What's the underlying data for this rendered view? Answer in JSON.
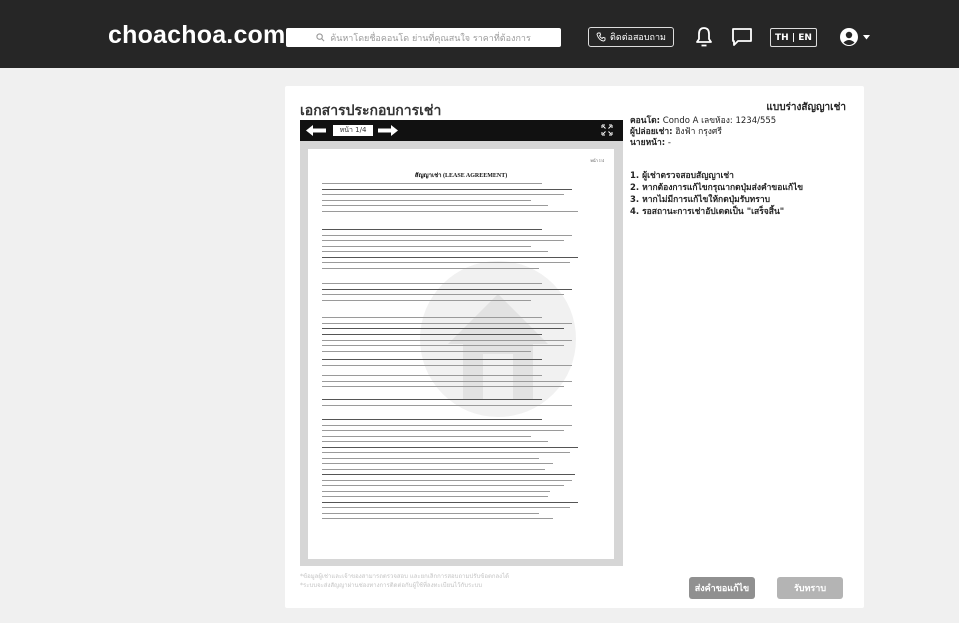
{
  "header": {
    "logo": "choachoa.com",
    "search_placeholder": "ค้นหาโดยชื่อคอนโด ย่านที่คุณสนใจ ราคาที่ต้องการ",
    "contact_label": "ติดต่อสอบถาม",
    "lang_label": "TH | EN"
  },
  "document": {
    "title": "เอกสารประกอบการเช่า",
    "form_type": "แบบร่างสัญญาเช่า",
    "page_indicator": "หน้า 1/4",
    "paper_page": "หน้า 1/4",
    "paper_title": "สัญญาเช่า (LEASE AGREEMENT)"
  },
  "info": {
    "condo_label": "คอนโด:",
    "condo_value": "Condo A เลขห้อง: 1234/555",
    "lessor_label": "ผู้ปล่อยเช่า:",
    "lessor_value": "ฮิงฟ้า กรุงศรี",
    "agent_label": "นายหน้า:",
    "agent_value": "-"
  },
  "steps": [
    "1. ผู้เช่าตรวจสอบสัญญาเช่า",
    "2. หากต้องการแก้ไขกรุณากดปุ่มส่งคำขอแก้ไข",
    "3. หากไม่มีการแก้ไขให้กดปุ่มรับทราบ",
    "4. รอสถานะการเช่าอัปเดตเป็น \"เสร็จสิ้น\""
  ],
  "footnotes": [
    "*ข้อมูลผู้เช่าและเจ้าของสามารถตรวจสอบ และยกเลิกการสอบถามปรับข้อตกลงได้",
    "*ระบบจะส่งสัญญาผ่านช่องทางการติดต่อกับผู้ใช้ที่ลงทะเบียนไว้กับระบบ"
  ],
  "buttons": {
    "request_edit": "ส่งคำขอแก้ไข",
    "acknowledge": "รับทราบ"
  },
  "colors": {
    "topbar": "#262626",
    "background": "#f0f0f0",
    "request_btn": "#909090",
    "ack_btn": "#b4b4b4"
  }
}
